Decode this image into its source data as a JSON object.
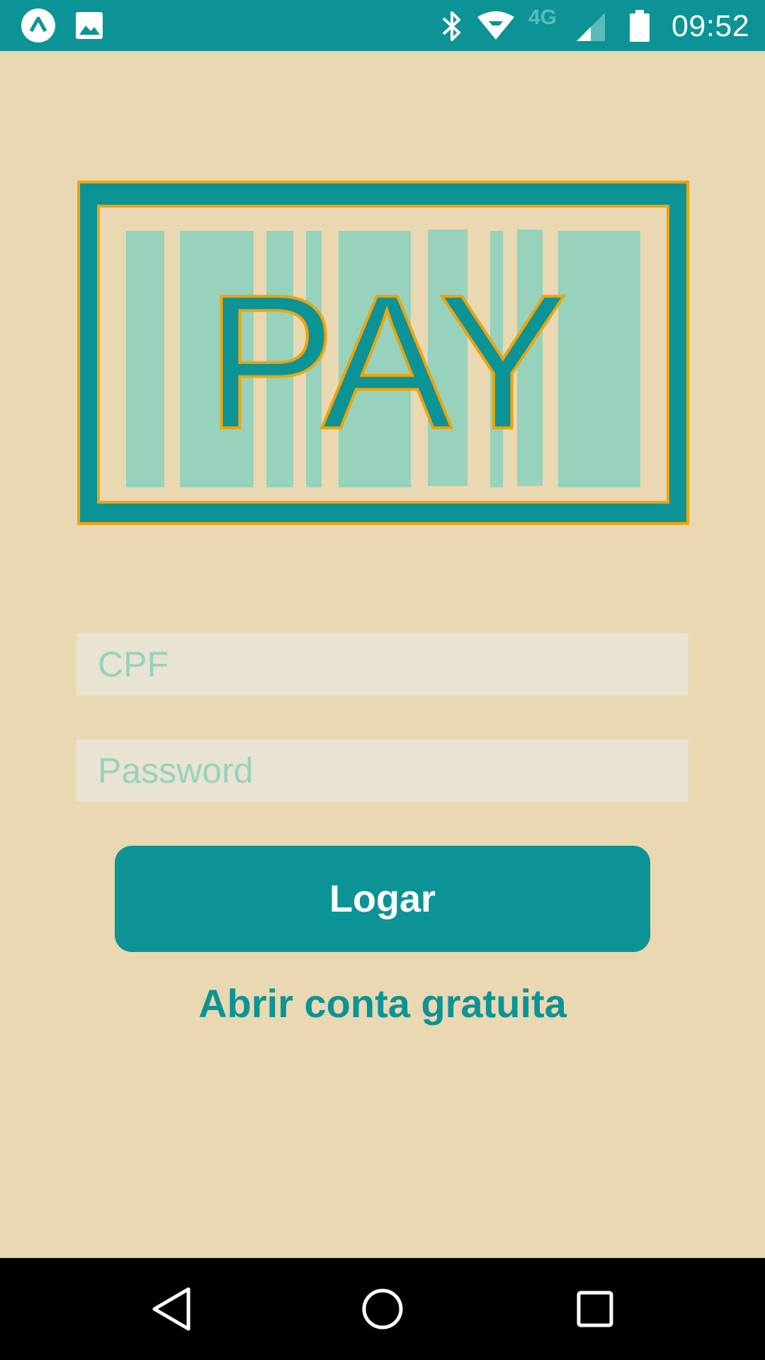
{
  "status_bar": {
    "time": "09:52",
    "network": "4G",
    "icons": [
      "app-icon",
      "gallery-icon",
      "bluetooth-icon",
      "wifi-icon",
      "signal-icon",
      "battery-icon"
    ]
  },
  "logo": {
    "text": "PAY"
  },
  "form": {
    "cpf_placeholder": "CPF",
    "password_placeholder": "Password",
    "login_label": "Logar",
    "open_account_label": "Abrir conta gratuita"
  },
  "nav": {
    "icons": [
      "back-icon",
      "home-icon",
      "recents-icon"
    ]
  },
  "colors": {
    "primary": "#0b9396",
    "background": "#e9d8b1",
    "accent": "#f0a30a",
    "barcode": "#97d2bd",
    "input_background": "#e9e3d1"
  }
}
